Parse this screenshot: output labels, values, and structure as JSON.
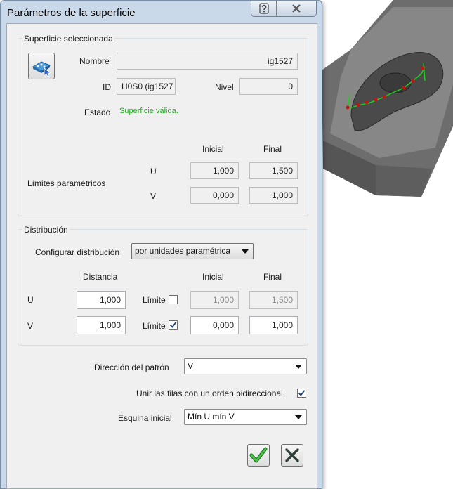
{
  "window": {
    "title": "Parámetros de la superficie"
  },
  "surface": {
    "group_title": "Superficie seleccionada",
    "name_label": "Nombre",
    "name_value": "ig1527",
    "id_label": "ID",
    "id_value": "H0S0 (ig1527",
    "level_label": "Nivel",
    "level_value": "0",
    "state_label": "Estado",
    "state_value": "Superficie válida.",
    "state_color": "#22aa22",
    "col_initial": "Inicial",
    "col_final": "Final",
    "limits_label": "Límites paramétricos",
    "u_label": "U",
    "v_label": "V",
    "u_initial": "1,000",
    "u_final": "1,500",
    "v_initial": "0,000",
    "v_final": "1,000"
  },
  "distribution": {
    "group_title": "Distribución",
    "config_label": "Configurar distribución",
    "config_value": "por unidades paramétrica",
    "col_distance": "Distancia",
    "col_initial": "Inicial",
    "col_final": "Final",
    "u_label": "U",
    "v_label": "V",
    "limit_label": "Límite",
    "u_distance": "1,000",
    "u_limit_checked": false,
    "u_initial": "1,000",
    "u_final": "1,500",
    "v_distance": "1,000",
    "v_limit_checked": true,
    "v_initial": "0,000",
    "v_final": "1,000"
  },
  "pattern": {
    "direction_label": "Dirección del patrón",
    "direction_value": "V",
    "bidirectional_label": "Unir las filas con un orden bidireccional",
    "bidirectional_checked": true,
    "start_corner_label": "Esquina inicial",
    "start_corner_value": "Mín U mín V"
  },
  "icons": {
    "help": "question-mark-icon",
    "close": "close-x-icon",
    "select_surface": "select-surface-icon",
    "ok": "green-check-icon",
    "cancel": "dark-x-icon"
  }
}
